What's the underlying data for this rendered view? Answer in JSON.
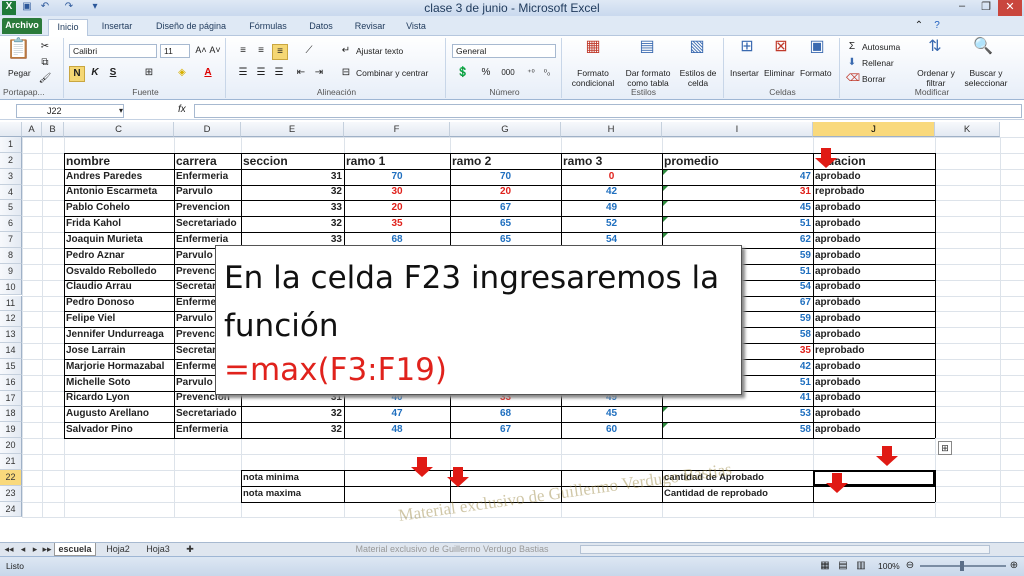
{
  "window": {
    "title": "clase 3 de junio - Microsoft Excel"
  },
  "tabs": [
    "Archivo",
    "Inicio",
    "Insertar",
    "Diseño de página",
    "Fórmulas",
    "Datos",
    "Revisar",
    "Vista"
  ],
  "ribbon": {
    "portapapeles": {
      "paste": "Pegar",
      "label": "Portapap..."
    },
    "fuente": {
      "font": "Calibri",
      "size": "11",
      "bold": "N",
      "italic": "K",
      "underline": "S",
      "label": "Fuente"
    },
    "alineacion": {
      "wrap": "Ajustar texto",
      "merge": "Combinar y centrar",
      "label": "Alineación"
    },
    "numero": {
      "format": "General",
      "percent": "%",
      "thousands": "000",
      "label": "Número"
    },
    "estilos": {
      "cond": "Formato condicional",
      "table": "Dar formato como tabla",
      "cellstyles": "Estilos de celda",
      "label": "Estilos"
    },
    "celdas": {
      "insert": "Insertar",
      "delete": "Eliminar",
      "format": "Formato",
      "label": "Celdas"
    },
    "modificar": {
      "autosum": "Autosuma",
      "fill": "Rellenar",
      "clear": "Borrar",
      "sort": "Ordenar y filtrar",
      "find": "Buscar y seleccionar",
      "label": "Modificar"
    }
  },
  "namebox": "J22",
  "fx": "fx",
  "columns": [
    "A",
    "B",
    "C",
    "D",
    "E",
    "F",
    "G",
    "H",
    "I",
    "J",
    "K"
  ],
  "rows": [
    "1",
    "2",
    "3",
    "4",
    "5",
    "6",
    "7",
    "8",
    "9",
    "10",
    "11",
    "12",
    "13",
    "14",
    "15",
    "16",
    "17",
    "18",
    "19",
    "20",
    "21",
    "22",
    "23",
    "24"
  ],
  "headers": {
    "nombre": "nombre",
    "carrera": "carrera",
    "seccion": "seccion",
    "ramo1": "ramo 1",
    "ramo2": "ramo 2",
    "ramo3": "ramo 3",
    "promedio": "promedio",
    "situacion": "uacion"
  },
  "students": [
    {
      "nombre": "Andres Paredes",
      "carrera": "Enfermeria",
      "seccion": "31",
      "r1": "70",
      "r2": "70",
      "r3": "0",
      "prom": "47",
      "sit": "aprobado"
    },
    {
      "nombre": "Antonio Escarmeta",
      "carrera": "Parvulo",
      "seccion": "32",
      "r1": "30",
      "r2": "20",
      "r3": "42",
      "prom": "31",
      "sit": "reprobado"
    },
    {
      "nombre": "Pablo Cohelo",
      "carrera": "Prevencion",
      "seccion": "33",
      "r1": "20",
      "r2": "67",
      "r3": "49",
      "prom": "45",
      "sit": "aprobado"
    },
    {
      "nombre": "Frida Kahol",
      "carrera": "Secretariado",
      "seccion": "32",
      "r1": "35",
      "r2": "65",
      "r3": "52",
      "prom": "51",
      "sit": "aprobado"
    },
    {
      "nombre": "Joaquin Murieta",
      "carrera": "Enfermeria",
      "seccion": "33",
      "r1": "68",
      "r2": "65",
      "r3": "54",
      "prom": "62",
      "sit": "aprobado"
    },
    {
      "nombre": "Pedro Aznar",
      "carrera": "Parvulo",
      "seccion": "",
      "r1": "",
      "r2": "",
      "r3": "",
      "prom": "59",
      "sit": "aprobado"
    },
    {
      "nombre": "Osvaldo Rebolledo",
      "carrera": "Prevenc",
      "seccion": "",
      "r1": "",
      "r2": "",
      "r3": "",
      "prom": "51",
      "sit": "aprobado"
    },
    {
      "nombre": "Claudio Arrau",
      "carrera": "Secretar",
      "seccion": "",
      "r1": "",
      "r2": "",
      "r3": "",
      "prom": "54",
      "sit": "aprobado"
    },
    {
      "nombre": "Pedro Donoso",
      "carrera": "Enferme",
      "seccion": "",
      "r1": "",
      "r2": "",
      "r3": "",
      "prom": "67",
      "sit": "aprobado"
    },
    {
      "nombre": "Felipe Viel",
      "carrera": "Parvulo",
      "seccion": "",
      "r1": "",
      "r2": "",
      "r3": "",
      "prom": "59",
      "sit": "aprobado"
    },
    {
      "nombre": "Jennifer Undurreaga",
      "carrera": "Prevenc",
      "seccion": "",
      "r1": "",
      "r2": "",
      "r3": "",
      "prom": "58",
      "sit": "aprobado"
    },
    {
      "nombre": "Jose Larrain",
      "carrera": "Secretar",
      "seccion": "",
      "r1": "",
      "r2": "",
      "r3": "",
      "prom": "35",
      "sit": "reprobado"
    },
    {
      "nombre": "Marjorie Hormazabal",
      "carrera": "Enferme",
      "seccion": "",
      "r1": "",
      "r2": "",
      "r3": "",
      "prom": "42",
      "sit": "aprobado"
    },
    {
      "nombre": "Michelle Soto",
      "carrera": "Parvulo",
      "seccion": "",
      "r1": "",
      "r2": "",
      "r3": "",
      "prom": "51",
      "sit": "aprobado"
    },
    {
      "nombre": "Ricardo Lyon",
      "carrera": "Prevencion",
      "seccion": "31",
      "r1": "40",
      "r2": "33",
      "r3": "49",
      "prom": "41",
      "sit": "aprobado"
    },
    {
      "nombre": "Augusto Arellano",
      "carrera": "Secretariado",
      "seccion": "32",
      "r1": "47",
      "r2": "68",
      "r3": "45",
      "prom": "53",
      "sit": "aprobado"
    },
    {
      "nombre": "Salvador Pino",
      "carrera": "Enfermeria",
      "seccion": "32",
      "r1": "48",
      "r2": "67",
      "r3": "60",
      "prom": "58",
      "sit": "aprobado"
    }
  ],
  "summary": {
    "min": "nota minima",
    "max": "nota maxima",
    "aprob": "cantidad de Aprobado",
    "reprob": "Cantidad de reprobado"
  },
  "overlay": {
    "line1": "En la celda F23 ingresaremos la función",
    "line2": "=max(F3:F19)"
  },
  "sheets": [
    "escuela",
    "Hoja2",
    "Hoja3"
  ],
  "status": {
    "ready": "Listo",
    "zoom": "100%"
  },
  "watermark": "Material exclusivo de Guillermo Verdugo Bastias",
  "colors": {
    "blue": "#1f6fbf",
    "red": "#e0221c",
    "arrow": "#e01a14"
  }
}
